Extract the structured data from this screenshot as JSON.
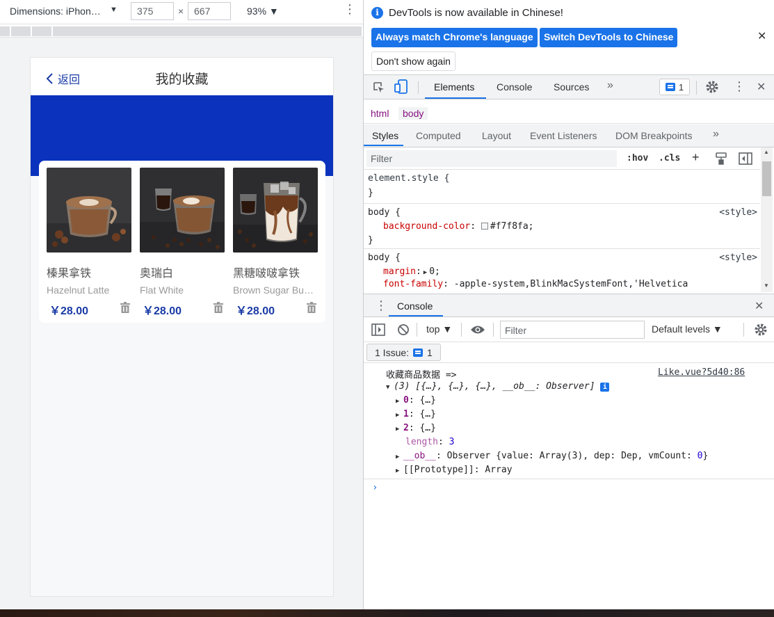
{
  "device_toolbar": {
    "device_label": "Dimensions: iPhon…",
    "width": "375",
    "height": "667",
    "times": "×",
    "zoom": "93%"
  },
  "app": {
    "back_label": "返回",
    "title": "我的收藏",
    "banner_color": "#0a32bd",
    "products": [
      {
        "name_cn": "榛果拿铁",
        "name_en": "Hazelnut Latte",
        "price": "￥28.00",
        "image": "latte-with-hazelnuts"
      },
      {
        "name_cn": "奥瑞白",
        "name_en": "Flat White",
        "price": "￥28.00",
        "image": "flat-white-with-espresso"
      },
      {
        "name_cn": "黑糖啵啵拿铁",
        "name_en": "Brown Sugar Bu…",
        "price": "￥28.00",
        "image": "iced-brown-sugar-latte"
      }
    ]
  },
  "devtools": {
    "banner": {
      "message": "DevTools is now available in Chinese!",
      "btn_match": "Always match Chrome's language",
      "btn_switch": "Switch DevTools to Chinese",
      "btn_dont_show": "Don't show again"
    },
    "main_tabs": [
      "Elements",
      "Console",
      "Sources"
    ],
    "more": "»",
    "issues_count": "1",
    "breadcrumbs": [
      "html",
      "body"
    ],
    "styles_tabs": [
      "Styles",
      "Computed",
      "Layout",
      "Event Listeners",
      "DOM Breakpoints"
    ],
    "filter_placeholder": "Filter",
    "hov": ":hov",
    "cls": ".cls",
    "rules": {
      "element_style": "element.style {",
      "close": "}",
      "body1_selector": "body {",
      "body1_source": "<style>",
      "body1_prop": "background-color",
      "body1_value": "#f7f8fa;",
      "body2_selector": "body {",
      "body2_source": "<style>",
      "body2_prop1": "margin",
      "body2_value1": "0;",
      "body2_prop2": "font-family",
      "body2_value2": "-apple-system,BlinkMacSystemFont,'Helvetica"
    },
    "drawer_tab": "Console",
    "console_context": "top",
    "console_filter_placeholder": "Filter",
    "default_levels": "Default levels",
    "issue_button": "1 Issue:",
    "issue_count": "1",
    "log": {
      "message": "收藏商品数据 =>",
      "source": "Like.vue?5d40:86",
      "array_summary": "(3) [{…}, {…}, {…}, __ob__: Observer]",
      "item0_key": "0",
      "item1_key": "1",
      "item2_key": "2",
      "item_preview": "{…}",
      "length_key": "length",
      "length_value": "3",
      "ob_key": "__ob__",
      "ob_value_prefix": "Observer {value: Array(3), dep: Dep, vmCount: ",
      "ob_vmcount": "0",
      "ob_value_suffix": "}",
      "proto_key": "[[Prototype]]",
      "proto_value": "Array"
    }
  }
}
